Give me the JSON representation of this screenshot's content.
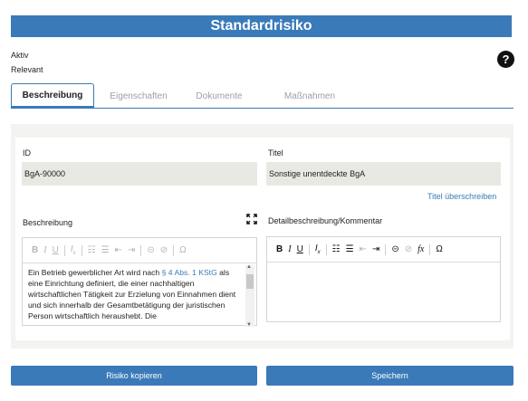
{
  "header": {
    "title": "Standardrisiko"
  },
  "status": {
    "line1": "Aktiv",
    "line2": "Relevant"
  },
  "help": {
    "glyph": "?"
  },
  "tabs": [
    {
      "label": "Beschreibung",
      "active": true
    },
    {
      "label": "Eigenschaften"
    },
    {
      "label": "Dokumente"
    },
    {
      "label": "Maßnahmen"
    }
  ],
  "form": {
    "id_label": "ID",
    "id_value": "BgA-90000",
    "title_label": "Titel",
    "title_value": "Sonstige unentdeckte BgA",
    "title_override_link": "Titel überschreiben",
    "description_label": "Beschreibung",
    "detail_label": "Detailbeschreibung/Kommentar",
    "description_text_before": "Ein Betrieb gewerblicher Art wird nach ",
    "description_ref": "§ 4 Abs. 1 KStG",
    "description_text_after": " als eine Einrichtung definiert, die einer nachhaltigen wirtschaftlichen Tätigkeit zur Erzielung von Einnahmen dient und sich innerhalb der Gesamtbetätigung der juristischen Person wirtschaftlich heraushebt. Die"
  },
  "buttons": {
    "copy": "Risiko kopieren",
    "save": "Speichern"
  },
  "colors": {
    "accent": "#3a7ab8"
  }
}
